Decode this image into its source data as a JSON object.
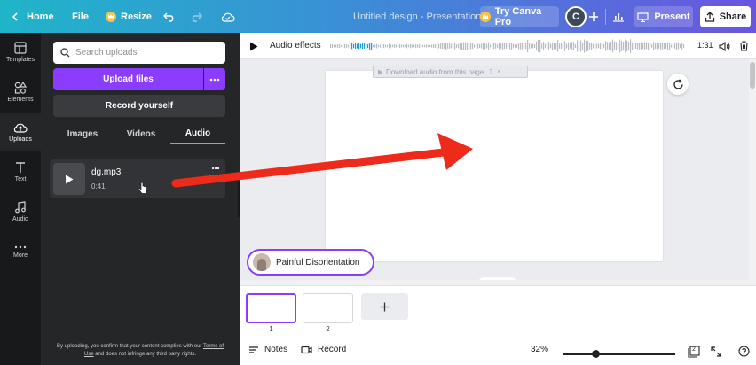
{
  "topbar": {
    "home_label": "Home",
    "file_label": "File",
    "resize_label": "Resize",
    "doc_title": "Untitled design - Presentation",
    "try_pro_label": "Try Canva Pro",
    "avatar_initial": "C",
    "present_label": "Present",
    "share_label": "Share"
  },
  "rail": {
    "items": [
      {
        "label": "Templates",
        "icon": "templates-icon"
      },
      {
        "label": "Elements",
        "icon": "elements-icon"
      },
      {
        "label": "Uploads",
        "icon": "uploads-icon"
      },
      {
        "label": "Text",
        "icon": "text-icon"
      },
      {
        "label": "Audio",
        "icon": "audio-icon"
      },
      {
        "label": "More",
        "icon": "more-icon"
      }
    ],
    "active": "Uploads"
  },
  "panel": {
    "search_placeholder": "Search uploads",
    "upload_label": "Upload files",
    "record_label": "Record yourself",
    "tabs": [
      "Images",
      "Videos",
      "Audio"
    ],
    "active_tab": "Audio",
    "audio_items": [
      {
        "name": "dg.mp3",
        "duration": "0:41"
      }
    ],
    "disclaimer_pre": "By uploading, you confirm that your content complies with our",
    "disclaimer_link": "Terms of Use",
    "disclaimer_post": "and does not infringe any third party rights."
  },
  "audio_bar": {
    "title": "Audio effects",
    "time": "1:31",
    "download_tip": "Download audio from this page"
  },
  "canvas": {
    "now_playing": "Painful Disorientation"
  },
  "pages": [
    {
      "number": "1",
      "selected": true
    },
    {
      "number": "2",
      "selected": false
    }
  ],
  "footer": {
    "notes_label": "Notes",
    "record_label": "Record",
    "zoom": "32%",
    "page_count": "2"
  },
  "colors": {
    "accent": "#8b3dff",
    "arrow": "#ee2a1a"
  }
}
